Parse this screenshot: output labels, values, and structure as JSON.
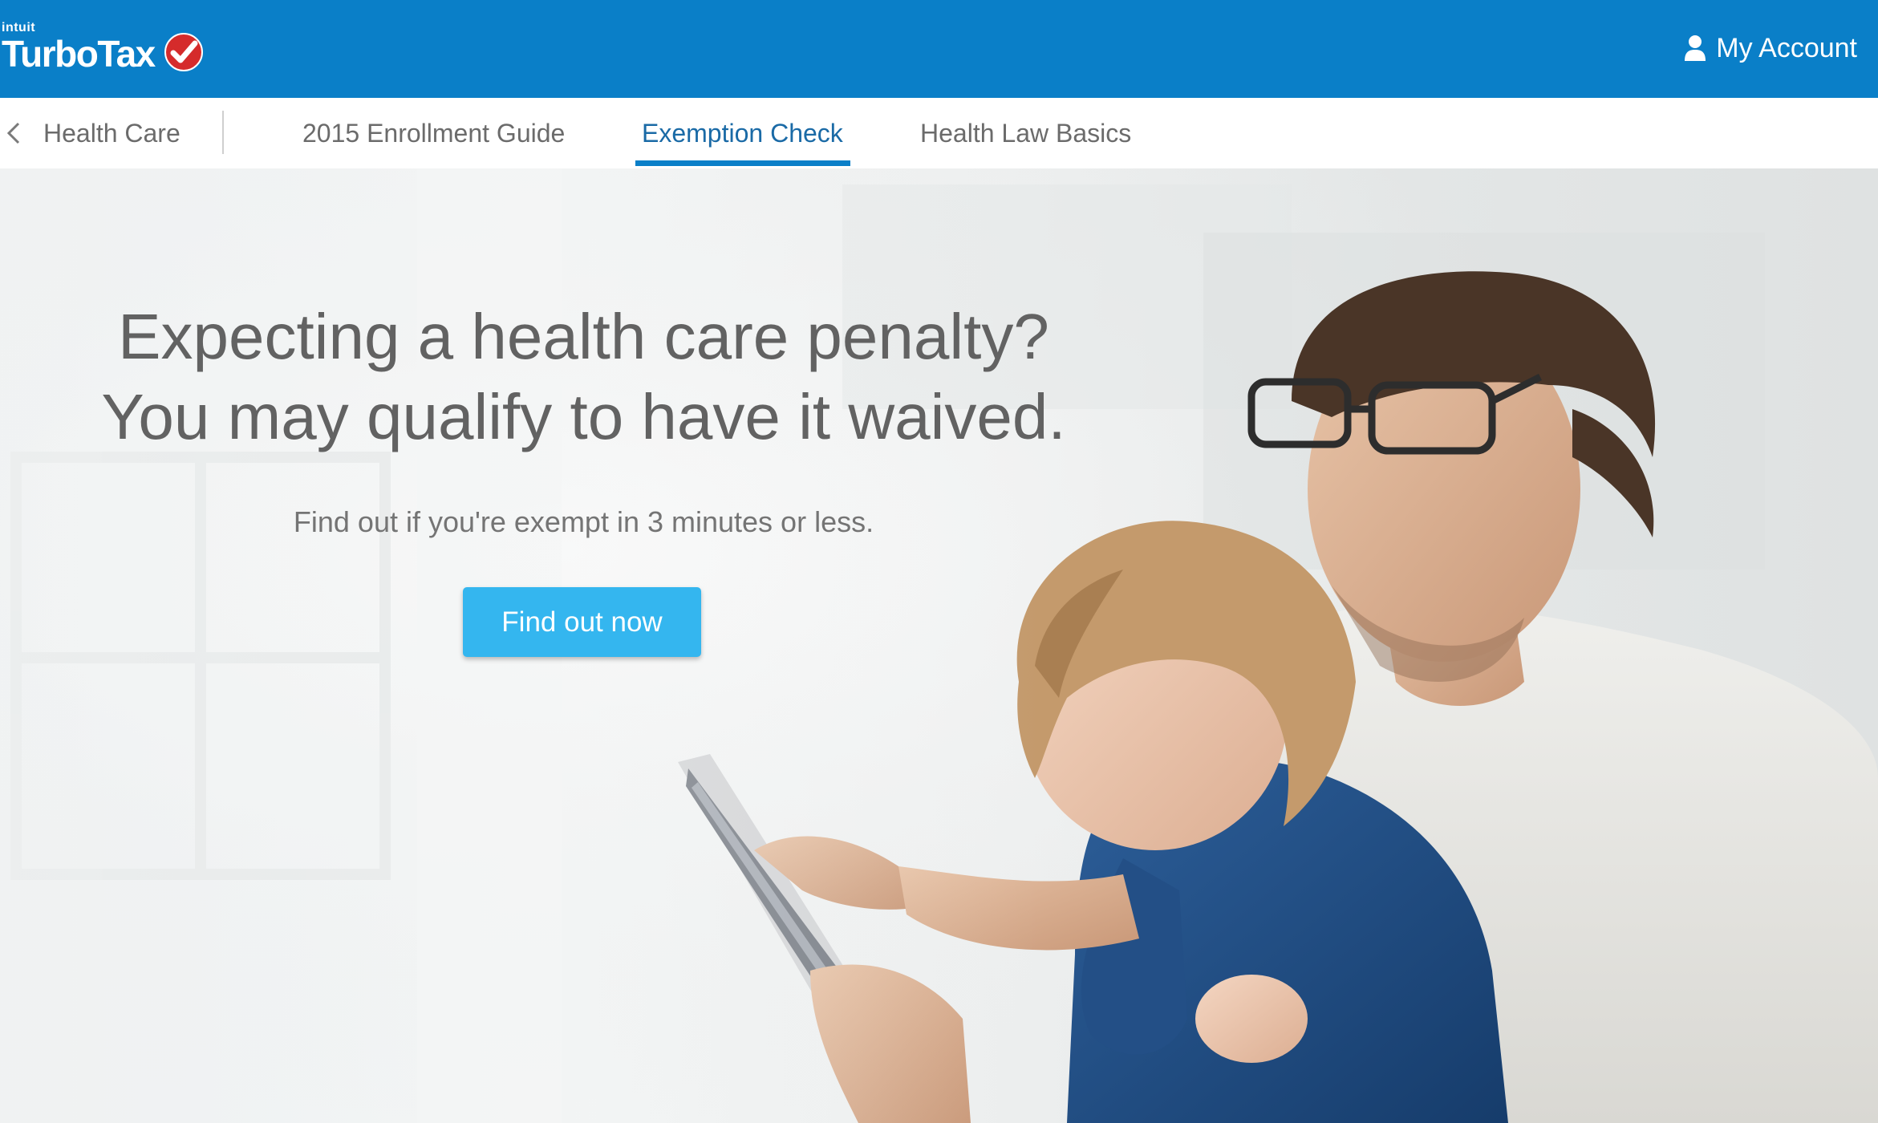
{
  "header": {
    "brand_parent": "intuit",
    "brand_name": "TurboTax",
    "account_label": "My Account",
    "account_icon": "user-icon",
    "brand_color": "#0a7fc8",
    "check_color": "#d52b2b"
  },
  "subnav": {
    "back_icon": "chevron-left-icon",
    "back_label": "Health Care",
    "tabs": [
      {
        "label": "2015 Enrollment Guide",
        "active": false
      },
      {
        "label": "Exemption Check",
        "active": true
      },
      {
        "label": "Health Law Basics",
        "active": false
      }
    ],
    "active_color": "#1a6aa6"
  },
  "hero": {
    "headline_line1": "Expecting a health care penalty?",
    "headline_line2": "You may qualify to have it waived.",
    "subhead": "Find out if you're exempt in 3 minutes or less.",
    "cta_label": "Find out now",
    "cta_color": "#34b6ef",
    "image": "photo of a father and toddler looking at a tablet"
  }
}
